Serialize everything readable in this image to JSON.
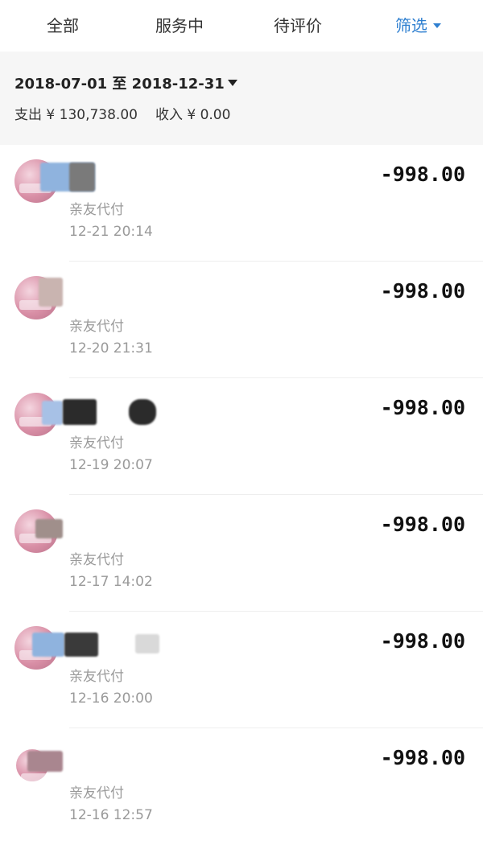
{
  "tabs": [
    {
      "label": "全部"
    },
    {
      "label": "服务中"
    },
    {
      "label": "待评价"
    }
  ],
  "filter": {
    "label": "筛选"
  },
  "summary": {
    "date_range": "2018-07-01 至 2018-12-31",
    "expense": "支出 ¥ 130,738.00",
    "income": "收入 ¥ 0.00"
  },
  "transactions": [
    {
      "type": "亲友代付",
      "time": "12-21  20:14",
      "amount": "-998.00"
    },
    {
      "type": "亲友代付",
      "time": "12-20  21:31",
      "amount": "-998.00"
    },
    {
      "type": "亲友代付",
      "time": "12-19  20:07",
      "amount": "-998.00"
    },
    {
      "type": "亲友代付",
      "time": "12-17  14:02",
      "amount": "-998.00"
    },
    {
      "type": "亲友代付",
      "time": "12-16  20:00",
      "amount": "-998.00"
    },
    {
      "type": "亲友代付",
      "time": "12-16  12:57",
      "amount": "-998.00"
    }
  ]
}
